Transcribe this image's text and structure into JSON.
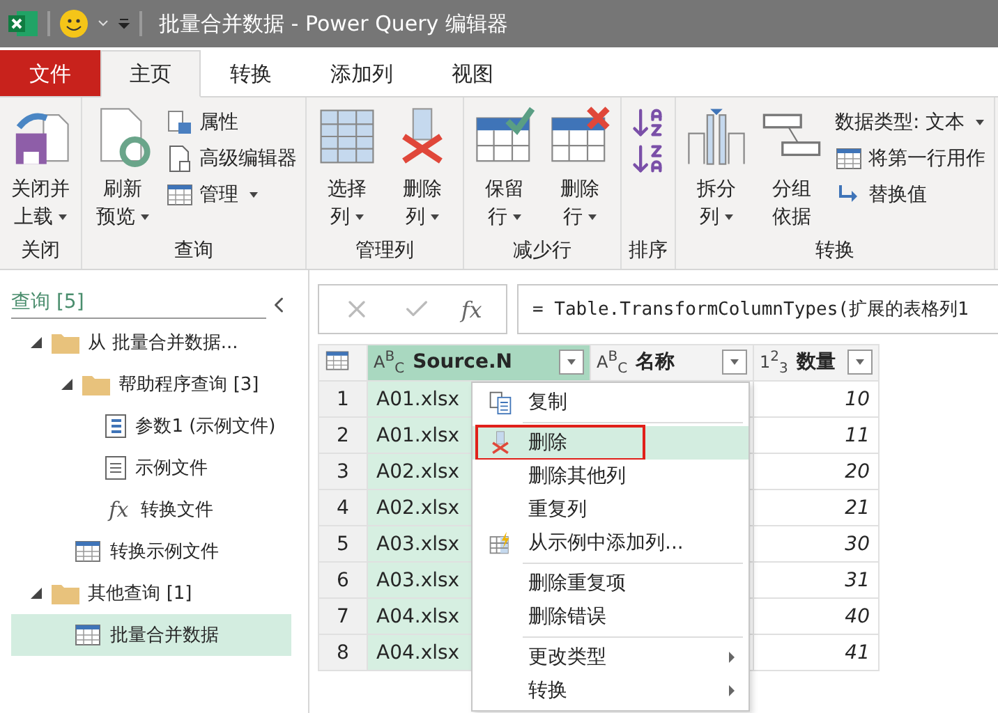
{
  "window": {
    "title": "批量合并数据 - Power Query 编辑器"
  },
  "tabs": [
    {
      "label": "文件",
      "kind": "file",
      "selected": false
    },
    {
      "label": "主页",
      "kind": "tab",
      "selected": true
    },
    {
      "label": "转换",
      "kind": "tab",
      "selected": false
    },
    {
      "label": "添加列",
      "kind": "tab",
      "selected": false
    },
    {
      "label": "视图",
      "kind": "tab",
      "selected": false
    }
  ],
  "ribbon": {
    "groups": [
      {
        "label": "关闭",
        "controls": [
          {
            "kind": "large",
            "lines": [
              "关闭并",
              "上载"
            ],
            "dropdown": true
          }
        ]
      },
      {
        "label": "查询",
        "controls": [
          {
            "kind": "large",
            "lines": [
              "刷新",
              "预览"
            ],
            "dropdown": true
          },
          {
            "kind": "stack",
            "items": [
              {
                "label": "属性",
                "dropdown": false
              },
              {
                "label": "高级编辑器",
                "dropdown": false
              },
              {
                "label": "管理",
                "dropdown": true
              }
            ]
          }
        ]
      },
      {
        "label": "管理列",
        "controls": [
          {
            "kind": "large",
            "lines": [
              "选择",
              "列"
            ],
            "dropdown": true
          },
          {
            "kind": "large",
            "lines": [
              "删除",
              "列"
            ],
            "dropdown": true
          }
        ]
      },
      {
        "label": "减少行",
        "controls": [
          {
            "kind": "large",
            "lines": [
              "保留",
              "行"
            ],
            "dropdown": true
          },
          {
            "kind": "large",
            "lines": [
              "删除",
              "行"
            ],
            "dropdown": true
          }
        ]
      },
      {
        "label": "排序",
        "controls": [
          {
            "kind": "stack",
            "items": [
              {
                "dropdown": false
              },
              {
                "dropdown": false
              }
            ]
          }
        ]
      },
      {
        "label": "转换",
        "controls": [
          {
            "kind": "large",
            "lines": [
              "拆分",
              "列"
            ],
            "dropdown": true
          },
          {
            "kind": "large",
            "lines": [
              "分组",
              "依据"
            ],
            "dropdown": false
          },
          {
            "kind": "stack",
            "items": [
              {
                "label": "数据类型: 文本",
                "dropdown": true
              },
              {
                "label": "将第一行用作",
                "dropdown": false
              },
              {
                "label": "替换值",
                "dropdown": false
              }
            ]
          }
        ]
      }
    ]
  },
  "queries_pane": {
    "title": "查询 [5]",
    "tree": [
      {
        "label": "从 批量合并数据...",
        "kind": "folder",
        "expanded": true,
        "selected": false,
        "children": [
          {
            "label": "帮助程序查询 [3]",
            "kind": "folder",
            "expanded": true,
            "selected": false,
            "children": [
              {
                "label": "参数1 (示例文件)",
                "kind": "parameter",
                "selected": false
              },
              {
                "label": "示例文件",
                "kind": "list",
                "selected": false
              },
              {
                "label": "转换文件",
                "kind": "function",
                "glyph": "fx",
                "selected": false
              }
            ]
          },
          {
            "label": "转换示例文件",
            "kind": "table",
            "selected": false
          }
        ]
      },
      {
        "label": "其他查询 [1]",
        "kind": "folder",
        "expanded": true,
        "selected": false,
        "children": [
          {
            "label": "批量合并数据",
            "kind": "table",
            "selected": true
          }
        ]
      }
    ]
  },
  "formula_bar": {
    "fx": "fx",
    "formula": "= Table.TransformColumnTypes(扩展的表格列1"
  },
  "table": {
    "columns": [
      {
        "type_label": "A$^{B}$$_{C}$",
        "name": "Source.N",
        "selected": true
      },
      {
        "type_label": "A$^{B}$$_{C}$",
        "name": "名称",
        "selected": false
      },
      {
        "type_label": "1$^{2}$$_{3}$",
        "name": "数量",
        "selected": false
      }
    ],
    "rows": [
      {
        "index": "1",
        "source": "A01.xlsx",
        "quantity": "10"
      },
      {
        "index": "2",
        "source": "A01.xlsx",
        "quantity": "11"
      },
      {
        "index": "3",
        "source": "A02.xlsx",
        "quantity": "20"
      },
      {
        "index": "4",
        "source": "A02.xlsx",
        "quantity": "21"
      },
      {
        "index": "5",
        "source": "A03.xlsx",
        "quantity": "30"
      },
      {
        "index": "6",
        "source": "A03.xlsx",
        "quantity": "31"
      },
      {
        "index": "7",
        "source": "A04.xlsx",
        "quantity": "40"
      },
      {
        "index": "8",
        "source": "A04.xlsx",
        "quantity": "41"
      }
    ]
  },
  "context_menu": {
    "items": [
      {
        "kind": "item",
        "label": "复制",
        "submenu": false,
        "selected": false,
        "marked": false
      },
      {
        "kind": "separator"
      },
      {
        "kind": "item",
        "label": "删除",
        "submenu": false,
        "selected": true,
        "marked": true
      },
      {
        "kind": "item",
        "label": "删除其他列",
        "submenu": false,
        "selected": false,
        "marked": false
      },
      {
        "kind": "item",
        "label": "重复列",
        "submenu": false,
        "selected": false,
        "marked": false
      },
      {
        "kind": "item",
        "label": "从示例中添加列...",
        "submenu": false,
        "selected": false,
        "marked": false
      },
      {
        "kind": "separator"
      },
      {
        "kind": "item",
        "label": "删除重复项",
        "submenu": false,
        "selected": false,
        "marked": false
      },
      {
        "kind": "item",
        "label": "删除错误",
        "submenu": false,
        "selected": false,
        "marked": false
      },
      {
        "kind": "separator"
      },
      {
        "kind": "item",
        "label": "更改类型",
        "submenu": true,
        "selected": false,
        "marked": false
      },
      {
        "kind": "item",
        "label": "转换",
        "submenu": true,
        "selected": false,
        "marked": false
      }
    ]
  }
}
